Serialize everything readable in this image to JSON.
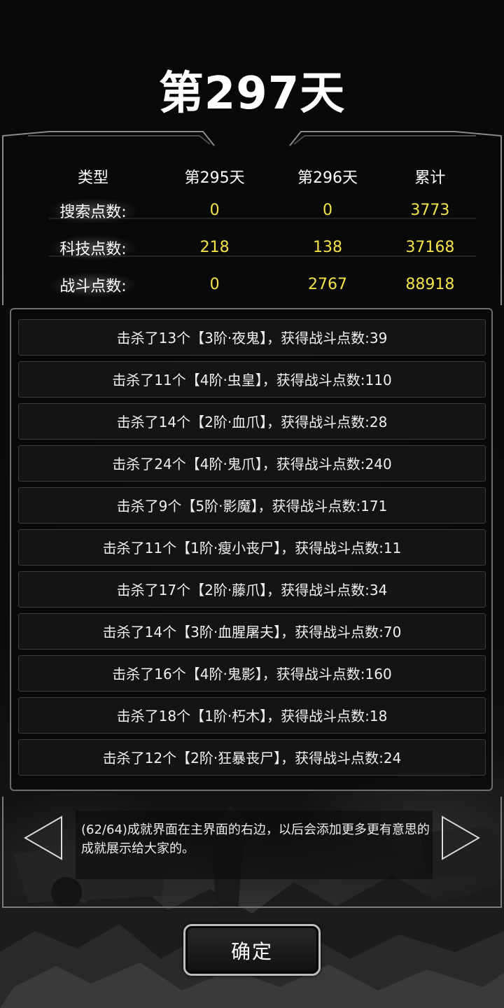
{
  "header": {
    "day_title": "第297天"
  },
  "stats": {
    "columns": [
      "类型",
      "第295天",
      "第296天",
      "累计"
    ],
    "rows": [
      {
        "label": "搜索点数:",
        "day295": "0",
        "day296": "0",
        "total": "3773"
      },
      {
        "label": "科技点数:",
        "day295": "218",
        "day296": "138",
        "total": "37168"
      },
      {
        "label": "战斗点数:",
        "day295": "0",
        "day296": "2767",
        "total": "88918"
      }
    ]
  },
  "kills": [
    "击杀了13个【3阶·夜鬼】，获得战斗点数:39",
    "击杀了11个【4阶·虫皇】，获得战斗点数:110",
    "击杀了14个【2阶·血爪】，获得战斗点数:28",
    "击杀了24个【4阶·鬼爪】，获得战斗点数:240",
    "击杀了9个【5阶·影魔】，获得战斗点数:171",
    "击杀了11个【1阶·瘦小丧尸】，获得战斗点数:11",
    "击杀了17个【2阶·藤爪】，获得战斗点数:34",
    "击杀了14个【3阶·血腥屠夫】，获得战斗点数:70",
    "击杀了16个【4阶·鬼影】，获得战斗点数:160",
    "击杀了18个【1阶·朽木】，获得战斗点数:18",
    "击杀了12个【2阶·狂暴丧尸】，获得战斗点数:24"
  ],
  "tip": {
    "text": "(62/64)成就界面在主界面的右边，以后会添加更多更有意思的成就展示给大家的。",
    "prev_icon": "triangle-left-icon",
    "next_icon": "triangle-right-icon"
  },
  "footer": {
    "confirm_label": "确定"
  },
  "colors": {
    "value_yellow": "#f3e24a",
    "text_white": "#ffffff",
    "panel_border": "#6e6e6e"
  }
}
